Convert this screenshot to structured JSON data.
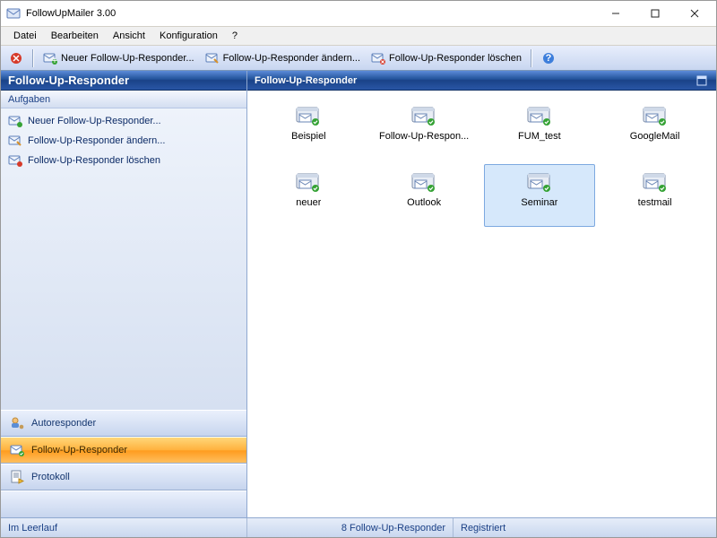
{
  "window": {
    "title": "FollowUpMailer 3.00"
  },
  "menu": {
    "items": [
      "Datei",
      "Bearbeiten",
      "Ansicht",
      "Konfiguration",
      "?"
    ]
  },
  "toolbar": {
    "new_label": "Neuer Follow-Up-Responder...",
    "edit_label": "Follow-Up-Responder ändern...",
    "delete_label": "Follow-Up-Responder löschen"
  },
  "sidebar": {
    "panel_title": "Follow-Up-Responder",
    "tasks_title": "Aufgaben",
    "tasks": [
      {
        "label": "Neuer Follow-Up-Responder...",
        "kind": "new"
      },
      {
        "label": "Follow-Up-Responder ändern...",
        "kind": "edit"
      },
      {
        "label": "Follow-Up-Responder löschen",
        "kind": "delete"
      }
    ],
    "nav": [
      {
        "label": "Autoresponder",
        "active": false
      },
      {
        "label": "Follow-Up-Responder",
        "active": true
      },
      {
        "label": "Protokoll",
        "active": false
      }
    ]
  },
  "main": {
    "title": "Follow-Up-Responder",
    "items": [
      {
        "label": "Beispiel",
        "selected": false
      },
      {
        "label": "Follow-Up-Respon...",
        "selected": false
      },
      {
        "label": "FUM_test",
        "selected": false
      },
      {
        "label": "GoogleMail",
        "selected": false
      },
      {
        "label": "neuer",
        "selected": false
      },
      {
        "label": "Outlook",
        "selected": false
      },
      {
        "label": "Seminar",
        "selected": true
      },
      {
        "label": "testmail",
        "selected": false
      }
    ]
  },
  "status": {
    "left": "Im Leerlauf",
    "center": "8 Follow-Up-Responder",
    "right": "Registriert"
  },
  "colors": {
    "accent": "#2a5fb0"
  }
}
